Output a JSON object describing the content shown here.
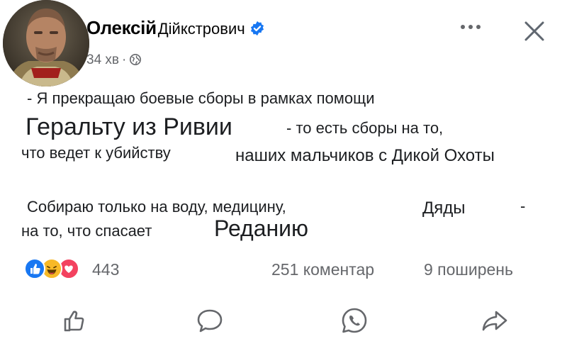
{
  "post": {
    "author_first": "Олексій",
    "author_second": "Дійкстрович",
    "time": "34 хв",
    "separator": "·",
    "icons": {
      "verified": "verified-badge-icon",
      "audience": "globe-icon",
      "more": "more-dots-icon",
      "close": "close-icon"
    }
  },
  "body": {
    "l1": "- Я прекращаю боевые сборы в рамках помощи",
    "l2a": "Геральту из Ривии",
    "l2b": "- то есть сборы на то,",
    "l3a": "что ведет к убийству",
    "l3b": "наших мальчиков с Дикой Охоты",
    "l4a": "Собираю только на воду, медицину,",
    "l4b": "Дяды",
    "l4c": "-",
    "l5a": "на то, что спасает",
    "l5b": "Реданию"
  },
  "stats": {
    "reaction_count": "443",
    "comments": "251 коментар",
    "shares": "9 поширень",
    "reaction_icons": [
      "like-reaction-icon",
      "haha-reaction-icon",
      "love-reaction-icon"
    ]
  },
  "actions": {
    "icons": [
      "like-icon",
      "comment-icon",
      "whatsapp-icon",
      "share-icon"
    ]
  },
  "colors": {
    "brand_blue": "#1877f2",
    "love_red": "#f3425f",
    "haha_yellow": "#f7b928",
    "muted": "#65676b"
  }
}
